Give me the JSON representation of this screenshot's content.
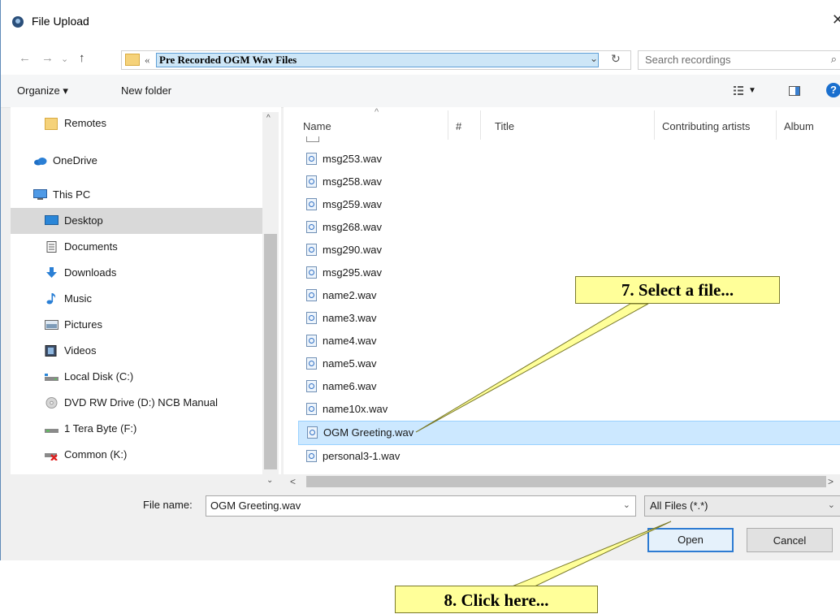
{
  "window": {
    "title": "File Upload",
    "close_glyph": "✕"
  },
  "address": {
    "breadcrumb_sep": "«",
    "current_folder": "Pre Recorded OGM Wav Files",
    "search_placeholder": "Search recordings"
  },
  "commands": {
    "organize": "Organize ▾",
    "new_folder": "New folder"
  },
  "navpane": {
    "items": [
      {
        "label": "Remotes",
        "icon": "folder-icon"
      },
      {
        "label": "OneDrive",
        "icon": "cloud-icon"
      },
      {
        "label": "This PC",
        "icon": "computer-icon"
      },
      {
        "label": "Desktop",
        "icon": "desktop-icon",
        "selected": true
      },
      {
        "label": "Documents",
        "icon": "documents-icon"
      },
      {
        "label": "Downloads",
        "icon": "download-icon"
      },
      {
        "label": "Music",
        "icon": "music-icon"
      },
      {
        "label": "Pictures",
        "icon": "pictures-icon"
      },
      {
        "label": "Videos",
        "icon": "videos-icon"
      },
      {
        "label": "Local Disk (C:)",
        "icon": "disk-icon"
      },
      {
        "label": "DVD RW Drive (D:) NCB Manual",
        "icon": "dvd-icon"
      },
      {
        "label": "1 Tera Byte (F:)",
        "icon": "drive-icon"
      },
      {
        "label": "Common (K:)",
        "icon": "network-drive-icon"
      }
    ]
  },
  "columns": {
    "name": "Name",
    "number": "#",
    "title": "Title",
    "artists": "Contributing artists",
    "album": "Album"
  },
  "files": [
    {
      "name": "msg253.wav"
    },
    {
      "name": "msg258.wav"
    },
    {
      "name": "msg259.wav"
    },
    {
      "name": "msg268.wav"
    },
    {
      "name": "msg290.wav"
    },
    {
      "name": "msg295.wav"
    },
    {
      "name": "name2.wav"
    },
    {
      "name": "name3.wav"
    },
    {
      "name": "name4.wav"
    },
    {
      "name": "name5.wav"
    },
    {
      "name": "name6.wav"
    },
    {
      "name": "name10x.wav"
    },
    {
      "name": "OGM Greeting.wav",
      "selected": true
    },
    {
      "name": "personal3-1.wav"
    }
  ],
  "footer": {
    "file_name_label": "File name:",
    "file_name_value": "OGM Greeting.wav",
    "file_type": "All Files (*.*)",
    "open_label": "Open",
    "cancel_label": "Cancel"
  },
  "annotations": {
    "step7": "7. Select a file...",
    "step8": "8. Click here..."
  },
  "colors": {
    "selection": "#cce8ff",
    "callout": "#ffff99",
    "accent": "#2d7bd2"
  }
}
